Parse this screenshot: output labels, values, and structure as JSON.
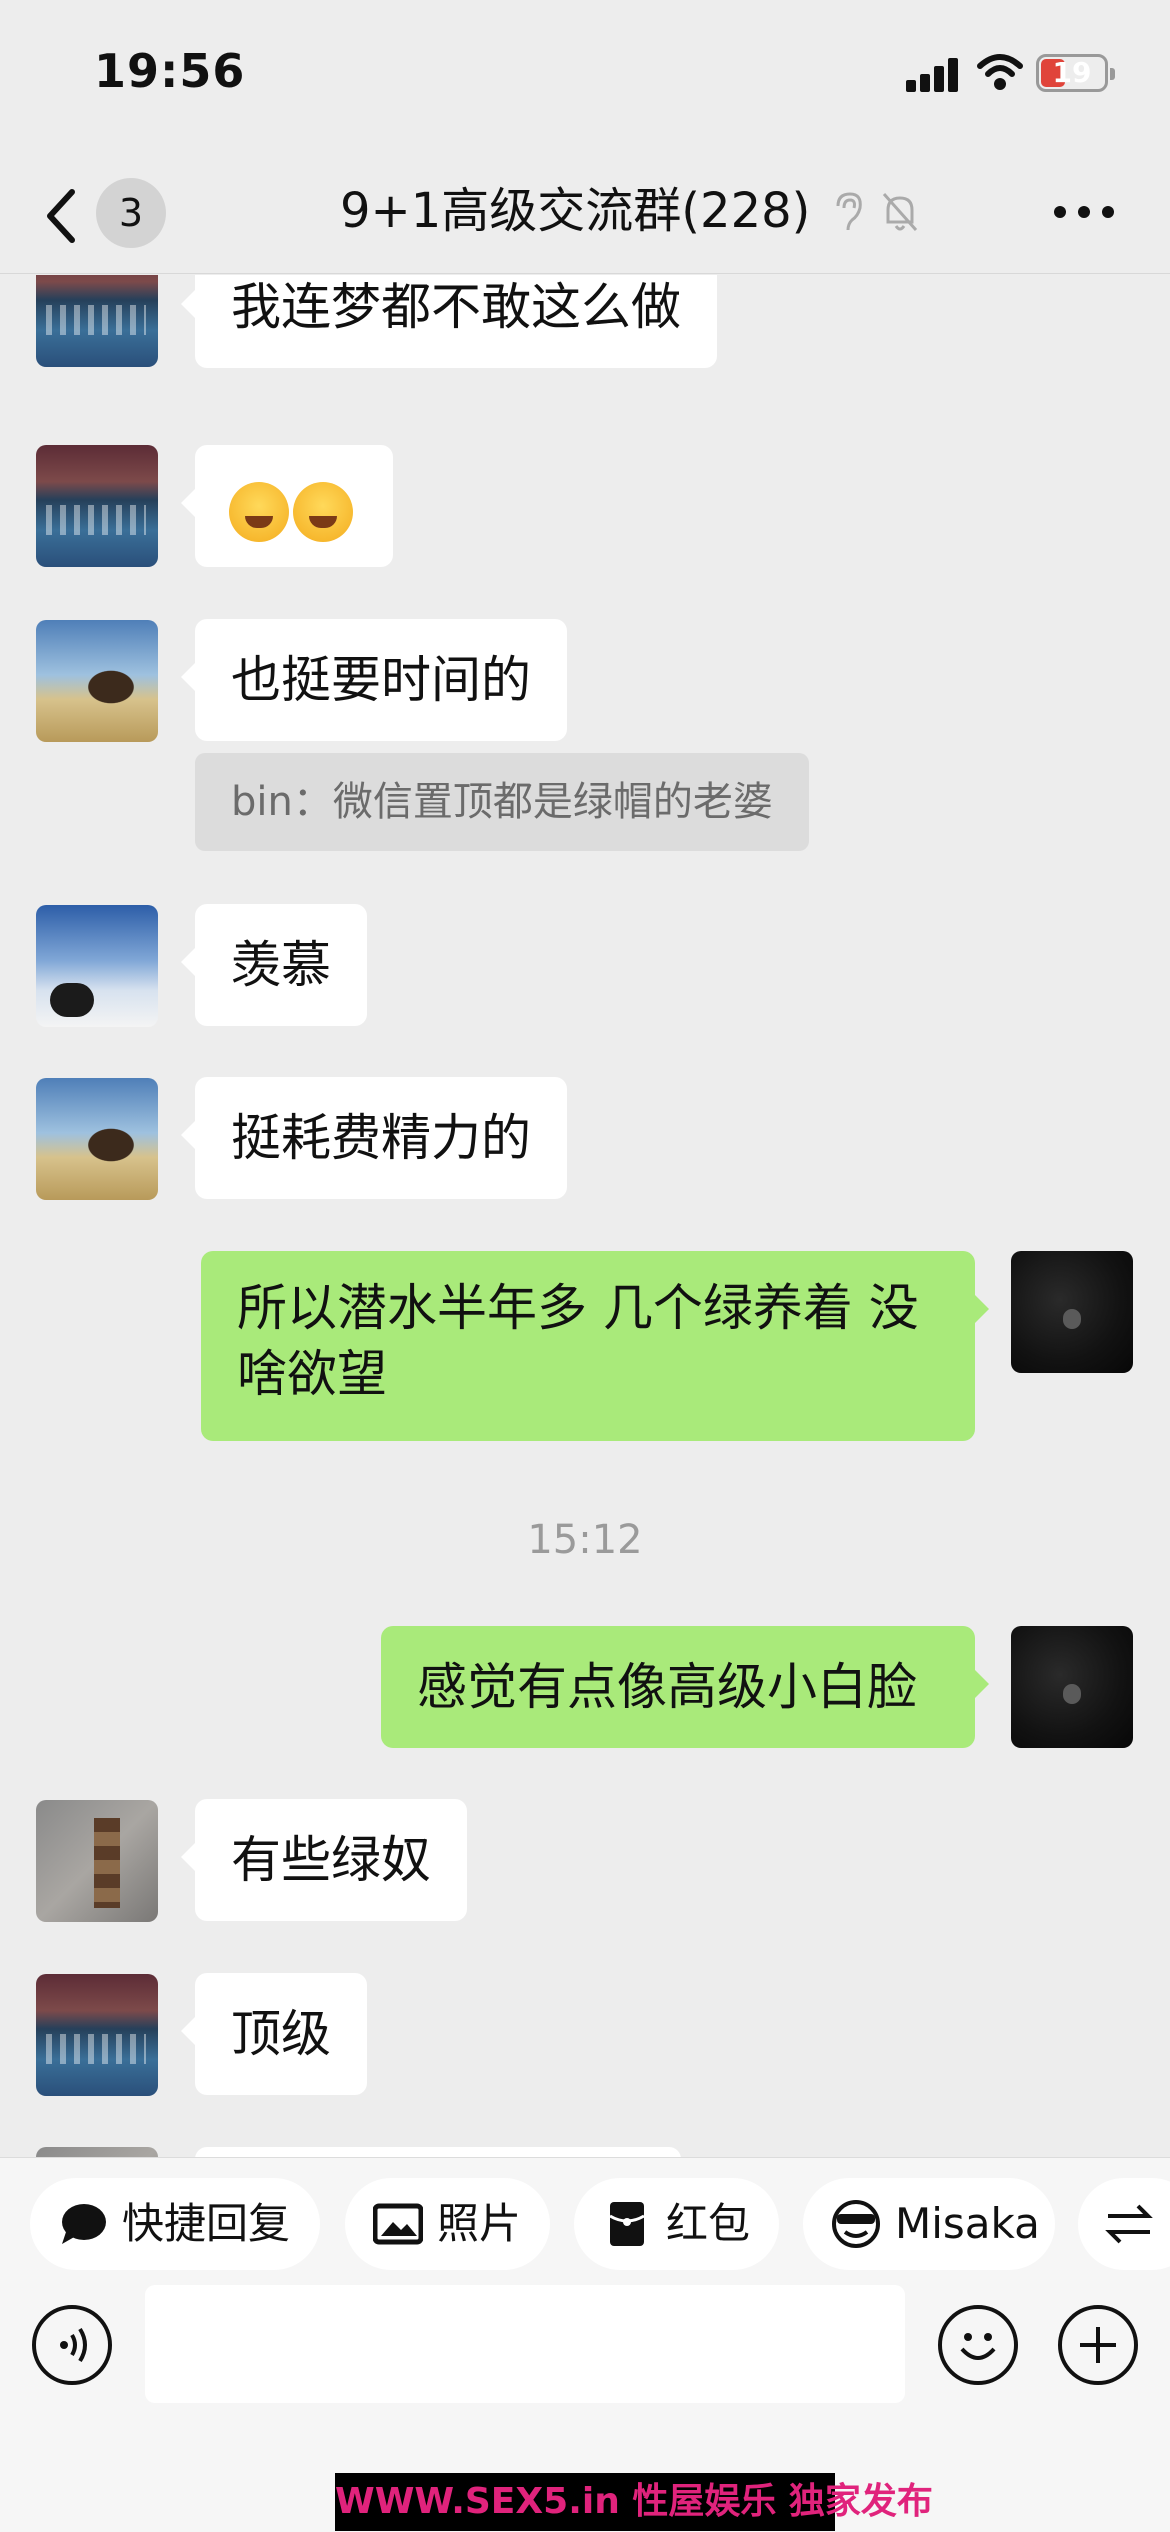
{
  "status_bar": {
    "time": "19:56",
    "battery": "19"
  },
  "nav": {
    "unread_count": "3",
    "title": "9+1高级交流群(228)"
  },
  "messages": [
    {
      "text": "我连梦都不敢这么做"
    },
    {
      "emoji": [
        "crying-laughing-emoji",
        "crying-laughing-emoji"
      ]
    },
    {
      "text": "也挺要时间的"
    },
    {
      "quote": "bin：微信置顶都是绿帽的老婆"
    },
    {
      "text": "羡慕"
    },
    {
      "text": "挺耗费精力的"
    },
    {
      "text": "所以潜水半年多 几个绿养着 没啥欲望"
    },
    {
      "timestamp": "15:12"
    },
    {
      "text": "感觉有点像高级小白脸"
    },
    {
      "text": "有些绿奴"
    },
    {
      "text": "顶级"
    }
  ],
  "quick_bar": {
    "quick_reply": "快捷回复",
    "photo": "照片",
    "red_packet": "红包",
    "misaka": "Misaka"
  },
  "watermark": "WWW.SEX5.in 性屋娱乐 独家发布"
}
